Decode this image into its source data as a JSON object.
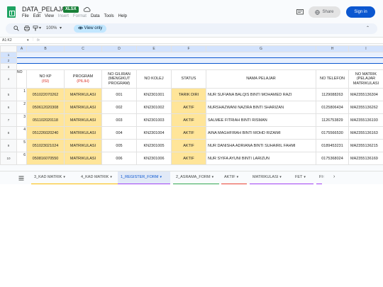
{
  "app": {
    "title": "DATA_PELAJAR",
    "badge": "XLSX",
    "menu": [
      "File",
      "Edit",
      "View",
      "Insert",
      "Format",
      "Data",
      "Tools",
      "Help"
    ],
    "share_label": "Share",
    "signin_label": "Sign in"
  },
  "toolbar": {
    "zoom": "100%",
    "view_only": "View only"
  },
  "formula": {
    "cell_ref": "A1:K2",
    "fx": "fx"
  },
  "columns": [
    "A",
    "B",
    "C",
    "D",
    "E",
    "F",
    "G",
    "H",
    "I"
  ],
  "row_numbers": [
    "1",
    "2",
    "3",
    "4",
    "5",
    "6",
    "7",
    "8",
    "9",
    "10"
  ],
  "header": {
    "no": "NO",
    "no_kp": "NO KP",
    "no_kp_sub": "(ISI)",
    "program": "PROGRAM",
    "program_sub": "(PILIH)",
    "no_giliran": "NO GILIRAN (MENGIKUT PROGRAM)",
    "no_kolej": "NO KOLEJ",
    "status": "STATUS",
    "nama": "NAMA PELAJAR",
    "telefon": "NO TELEFON",
    "matrik": "NO MATRIK (PELAJAR MATRIKULASI"
  },
  "rows": [
    {
      "no": "1",
      "kp": "051022070262",
      "program": "MATRIKULASI",
      "giliran": "001",
      "kolej": "KN2301001",
      "status": "TARIK DIRI",
      "nama": "NUR SUFIANA BALQIS BINTI MOHAMED RAZI",
      "telefon": "1129088263",
      "matrik": "MA2355136304"
    },
    {
      "no": "2",
      "kp": "050612020308",
      "program": "MATRIKULASI",
      "giliran": "002",
      "kolej": "KN2301002",
      "status": "AKTIF",
      "nama": "NURSHAZWANI NAZIRA BINTI SHARIZAN",
      "telefon": "0125806434",
      "matrik": "MA2355136262"
    },
    {
      "no": "3",
      "kp": "051102020118",
      "program": "MATRIKULASI",
      "giliran": "003",
      "kolej": "KN2301003",
      "status": "AKTIF",
      "nama": "SALMEE FITRIAH BINTI RISMAN",
      "telefon": "1126753829",
      "matrik": "MA2355136193"
    },
    {
      "no": "4",
      "kp": "051226020240",
      "program": "MATRIKULASI",
      "giliran": "004",
      "kolej": "KN2301004",
      "status": "AKTIF",
      "nama": "AINA MAGHFIRAH BINTI MOHD RIZAIMI",
      "telefon": "0175566530",
      "matrik": "MA2355136163"
    },
    {
      "no": "5",
      "kp": "051023021024",
      "program": "MATRIKULASI",
      "giliran": "005",
      "kolej": "KN2301005",
      "status": "AKTIF",
      "nama": "NUR DANISHA ADRIANA BINTI SUHAIRIL FAHMI",
      "telefon": "0189453231",
      "matrik": "MA2355136215"
    },
    {
      "no": "6",
      "kp": "050816070550",
      "program": "MATRIKULASI",
      "giliran": "006",
      "kolej": "KN2301006",
      "status": "AKTIF",
      "nama": "NUR SYIFA AYUNI BINTI LARIZUN",
      "telefon": "0175368024",
      "matrik": "MA2355136169"
    }
  ],
  "tabs": [
    {
      "label": "3_KAD MATRIK",
      "color": "#fbbc04"
    },
    {
      "label": "4_KAD MATRIK",
      "color": "#fbbc04"
    },
    {
      "label": "1_REGISTER_FORM",
      "color": "#a142f4"
    },
    {
      "label": "2_ASRAMA_FORM",
      "color": "#34a853"
    },
    {
      "label": "AKTIF",
      "color": "#ea4335"
    },
    {
      "label": "MATRIKULASI",
      "color": "#a142f4"
    },
    {
      "label": "FET",
      "color": "#a142f4"
    },
    {
      "label": "FI",
      "color": "#a142f4"
    }
  ],
  "colors": {
    "accent": "#0b57d0",
    "highlight": "#ffe599",
    "sheets_green": "#1ea362"
  }
}
